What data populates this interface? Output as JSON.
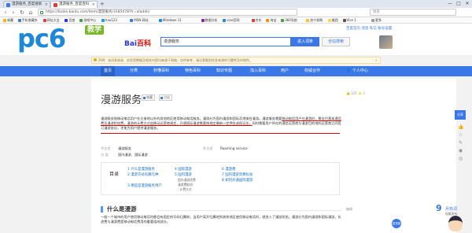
{
  "browser": {
    "tabs": [
      {
        "label": "漫游服务_百度搜索"
      },
      {
        "label": "漫游服务_百度百科"
      }
    ],
    "new_tab": "+",
    "window_controls": [
      "—",
      "□",
      "✕"
    ],
    "nav": {
      "back": "‹",
      "forward": "›",
      "reload": "↻",
      "home": "⌂"
    },
    "url": "https://baike.baidu.com/item/漫游服务/3185478?fr=aladdin",
    "right_search_placeholder": "搜索"
  },
  "bookmarks": [
    {
      "label": "收藏",
      "color": "#f5b400"
    },
    {
      "label": "手机收藏夹",
      "color": "#3b78e7"
    },
    {
      "label": "网址大全",
      "color": "#e53935"
    },
    {
      "label": "百度",
      "color": "#2932e1"
    },
    {
      "label": "游戏中心",
      "color": "#43a047"
    },
    {
      "label": "hao123",
      "color": "#2196f3"
    },
    {
      "label": "MSN 网站",
      "color": "#3b78e7"
    },
    {
      "label": "Windows 11",
      "color": "#1e88e5"
    },
    {
      "label": "数据分析",
      "color": "#8e24aa"
    },
    {
      "label": "vivo官网",
      "color": "#1e88e5"
    },
    {
      "label": "京东",
      "color": "#e53935"
    },
    {
      "label": "淘宝",
      "color": "#fb8c00"
    },
    {
      "label": "360导航",
      "color": "#43a047"
    },
    {
      "label": "苏宁易购",
      "color": "#fbc02d"
    },
    {
      "label": "美团",
      "color": "#fdd835"
    },
    {
      "label": "Vice 1",
      "color": "#6d4c41"
    },
    {
      "label": "更多",
      "color": "#9e9e9e"
    }
  ],
  "site": {
    "pc6_logo": "pc6",
    "pc6_badge": "教学",
    "baidu_logo_1": "Bai",
    "baidu_logo_2": "百科",
    "search_value": "漫游服务",
    "search_button": "进入词条",
    "search_button_2": "全站搜索",
    "user_links": "百度首页  消息  私信  账号设置",
    "notice": "声明：该词条收录、实验室数据及相关内容均来源于网络，仅供参考，请注意甄别信息来源的可靠性及时效性。",
    "notice_close": "✕"
  },
  "blue_nav": {
    "items": [
      "首页",
      "分类",
      "秒懂百科",
      "特色百科",
      "知识专题",
      "加入百科",
      "用户",
      "权威合作"
    ],
    "right": "个人中心"
  },
  "article": {
    "title": "漫游服务",
    "collect_label": "收藏",
    "edit_label": "讨论",
    "stats": "👍 321  ⭐ 3",
    "summary_part1": "漫游服务指移动电话用户在注册地以外的其他地区使用移动电话服务。漫游分为国内漫游和国际及港澳台漫游。漫游服务需要",
    "summary_highlight": "移动电话用户在漫游时，需支付基本通话费及漫游附加费，漫游的计费方式由移动运营商规定，开通国际漫游需要按规定缴纳一定押金或保证金，",
    "summary_part2": "同时需要用户所在的通信运营商与漫游目的地的运营商之间签订漫游协议，才能为用户提供漫游服务。",
    "infobox": [
      {
        "k": "中文名",
        "v": "漫游服务"
      },
      {
        "k": "外文名",
        "v": "Roaming service"
      },
      {
        "k": "分  类",
        "v": "国内漫游、国际漫游"
      }
    ],
    "toc_label": "目录",
    "toc": [
      {
        "n": "1",
        "label": "什么是漫游服务"
      },
      {
        "n": "2",
        "label": "漫游方式有哪几种"
      },
      {
        "n": "3",
        "label": "哪些是漫游服务用户"
      },
      {
        "n": "4",
        "label": "国际漫游"
      },
      {
        "n": "5",
        "label": "国内漫游"
      },
      {
        "n": "6",
        "label": "漫游费"
      },
      {
        "n": "7",
        "label": "国内漫游资费标准"
      },
      {
        "n": "8",
        "label": "如何开通国际漫游"
      }
    ],
    "toc_subs": [
      "国内漫游资费",
      "漫游费取消",
      "· 计费方式"
    ],
    "section_title": "什么是漫游",
    "section_edit": "编辑",
    "para": "一般一个城市的用户使用移动电话时都会有固定的号码归属地，当用户离开归属地到其他地区使用移动电话时，就进入了漫游状态。漫游分为国内漫游和国际漫游，长途费与漫游费是移动电话费用的重要组成部分。"
  },
  "sidebar": {
    "share": "分享",
    "icons": [
      "thumbs-up-icon",
      "star-icon",
      "comment-icon",
      "weibo-icon",
      "wechat-icon"
    ]
  },
  "hot_widget": {
    "number": "9",
    "title": "月热词",
    "subtitle": "权威发布"
  },
  "fab_label": "回顶部"
}
